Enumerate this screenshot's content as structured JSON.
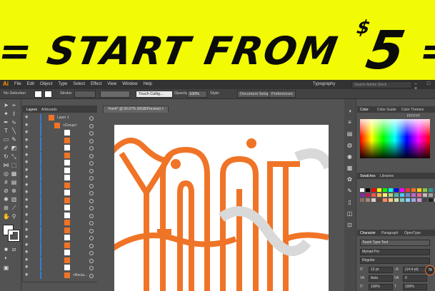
{
  "banner": {
    "prefix": "= START FROM ",
    "currency": "$",
    "amount": "5",
    "suffix": " ="
  },
  "app": {
    "logo": "Ai",
    "menus": [
      "File",
      "Edit",
      "Object",
      "Type",
      "Select",
      "Effect",
      "View",
      "Window",
      "Help"
    ],
    "workspace": "Typography",
    "search_placeholder": "Search Adobe Stock",
    "window_controls": "– □ ×"
  },
  "control_bar": {
    "selection": "No Selection",
    "stroke_label": "Stroke:",
    "brush_label": "Touch Callig...",
    "opacity_label": "Opacity:",
    "opacity_value": "100%",
    "style_label": "Style:",
    "doc_setup": "Document Setup",
    "preferences": "Preferences"
  },
  "layers_panel": {
    "tabs": [
      "Layers",
      "Artboards"
    ],
    "layer_name": "Layer 1",
    "group_name": "<Group>",
    "last_item": "<Recta..."
  },
  "document": {
    "tab_title": "Yvent* @ 66.67% (RGB/Preview)",
    "close": "×"
  },
  "color_panel": {
    "tabs": [
      "Color",
      "Color Guide",
      "Color Themes"
    ],
    "hex": "FFFFFF"
  },
  "swatches_panel": {
    "tabs": [
      "Swatches",
      "Libraries"
    ]
  },
  "character_panel": {
    "tabs": [
      "Character",
      "Paragraph",
      "OpenType"
    ],
    "tool_name": "Touch Type Tool",
    "font": "Myriad Pro",
    "style": "Regular",
    "size": "12 pt",
    "leading": "(14.4 pt)",
    "kerning": "Auto",
    "tracking": "0",
    "scale_h": "100%",
    "scale_v": "100%",
    "badge": "78"
  },
  "colors": {
    "accent": "#f07427",
    "banner_bg": "#f2fb03",
    "ribbon": "#d9d9d9"
  }
}
